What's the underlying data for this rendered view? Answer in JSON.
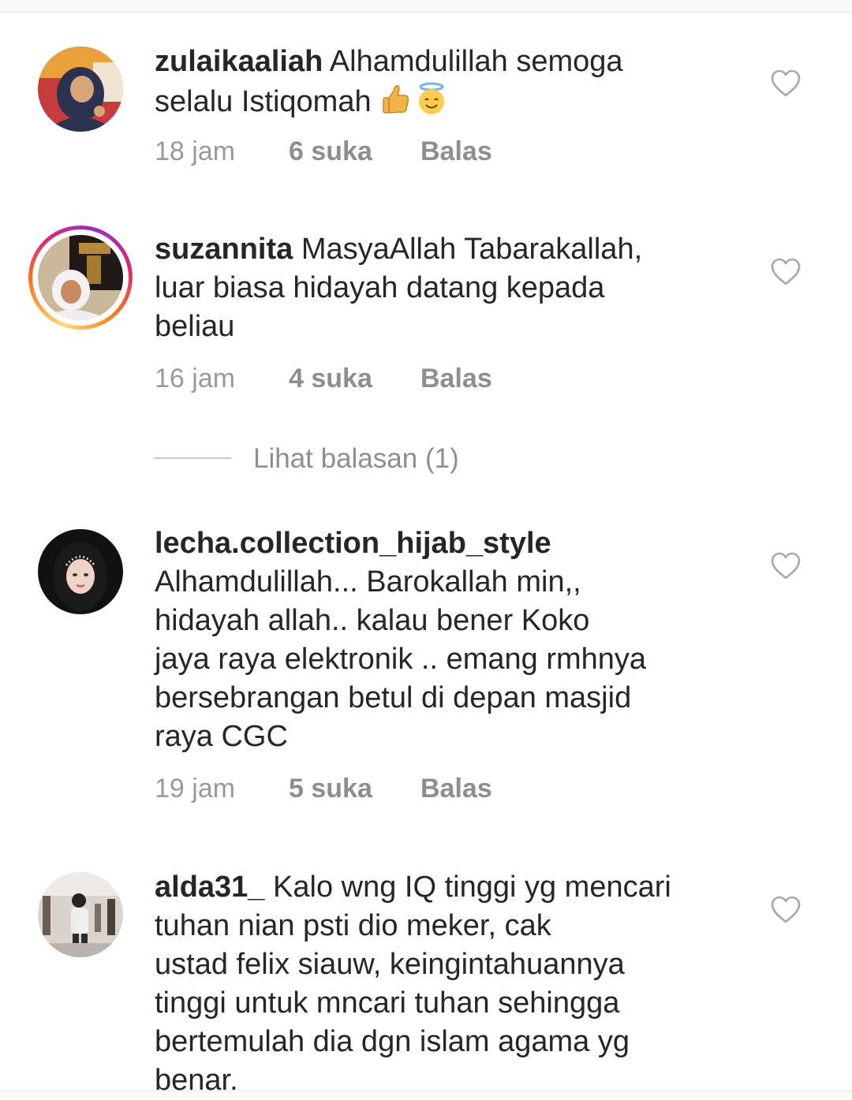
{
  "comments": [
    {
      "username": "zulaikaaliah",
      "text": "Alhamdulillah semoga\nselalu Istiqomah",
      "emojis": [
        "thumbs-up",
        "smiling-face-with-halo"
      ],
      "time": "18 jam",
      "likes": "6 suka",
      "reply": "Balas",
      "has_story_ring": false
    },
    {
      "username": "suzannita",
      "text": "MasyaAllah Tabarakallah,\nluar biasa hidayah datang kepada\nbeliau",
      "time": "16 jam",
      "likes": "4 suka",
      "reply": "Balas",
      "has_story_ring": true
    },
    {
      "username": "lecha.collection_hijab_style",
      "text": "Alhamdulillah... Barokallah min,,\nhidayah allah.. kalau bener Koko\njaya raya elektronik .. emang rmhnya\nbersebrangan betul di depan masjid\nraya CGC",
      "time": "19 jam",
      "likes": "5 suka",
      "reply": "Balas",
      "has_story_ring": false
    },
    {
      "username": "alda31_",
      "text": "Kalo wng IQ tinggi yg mencari\ntuhan nian psti dio meker, cak\nustad felix siauw, keingintahuannya\ntinggi untuk mncari tuhan sehingga\nbertemulah dia dgn islam agama yg\nbenar.",
      "has_story_ring": false
    }
  ],
  "view_replies": "Lihat balasan (1)",
  "colors": {
    "text": "#262626",
    "meta": "#8e8e8e",
    "story_ring": [
      "#feda75",
      "#fa7e1e",
      "#d62976",
      "#962fbf"
    ]
  }
}
